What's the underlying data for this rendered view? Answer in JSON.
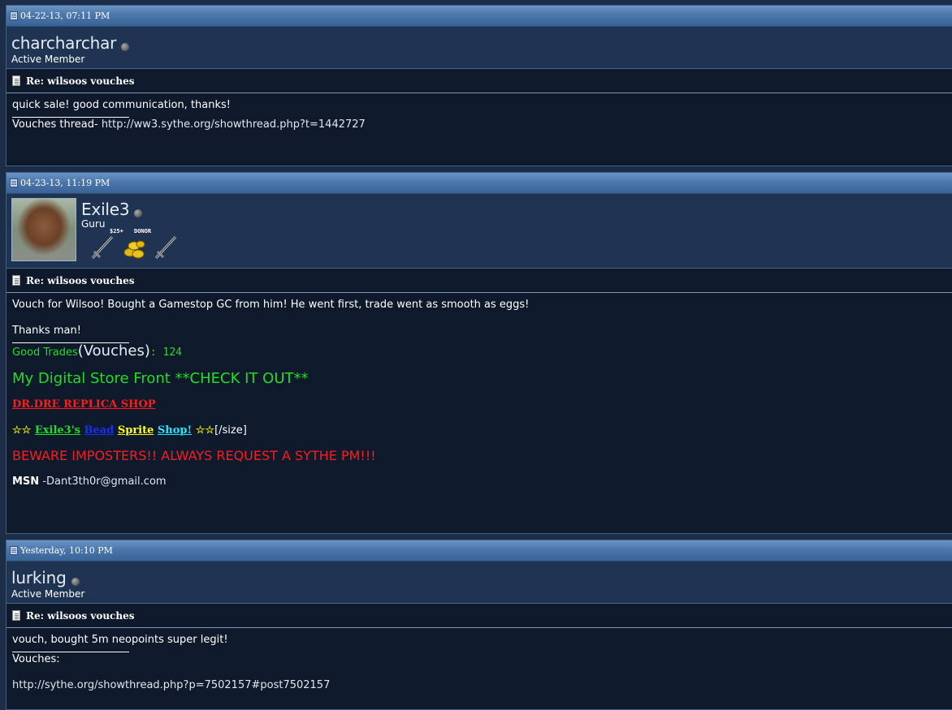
{
  "posts": [
    {
      "date": "04-22-13, 07:11 PM",
      "username": "charcharchar",
      "user_title": "Active Member",
      "message_title": "Re: wilsoos vouches",
      "message": "quick sale! good communication, thanks!",
      "signature": {
        "label": "Vouches thread-",
        "link": "http://ww3.sythe.org/showthread.php?t=1442727"
      }
    },
    {
      "date": "04-23-13, 11:19 PM",
      "username": "Exile3",
      "user_title": "Guru",
      "badges": {
        "badge1_label": "$25+",
        "badge2_label": "DONOR"
      },
      "message_title": "Re: wilsoos vouches",
      "message_line1": "Vouch for Wilsoo! Bought a Gamestop GC from him! He went first, trade went as smooth as eggs!",
      "message_line2": "Thanks man!",
      "signature": {
        "good_trades": "Good Trades",
        "vouches_word": "(Vouches)",
        "vouch_count": ": 124",
        "store_front": "My Digital Store Front **CHECK IT OUT**",
        "replica_shop": "DR.DRE REPLICA SHOP",
        "shop_stars_left": "☆☆",
        "shop_exile": "Exile3's",
        "shop_bead": "Bead",
        "shop_sprite": "Sprite",
        "shop_shop": "Shop!",
        "shop_stars_right": "☆☆",
        "shop_size_tag": "[/size]",
        "beware": "BEWARE IMPOSTERS!! ALWAYS REQUEST A SYTHE PM!!!",
        "msn_label": "MSN",
        "msn_value": "-Dant3th0r@gmail.com"
      }
    },
    {
      "date": "Yesterday, 10:10 PM",
      "username": "lurking",
      "user_title": "Active Member",
      "message_title": "Re: wilsoos vouches",
      "message": "vouch, bought 5m neopoints super legit!",
      "signature": {
        "label": "Vouches:",
        "link": "http://sythe.org/showthread.php?p=7502157#post7502157"
      }
    }
  ],
  "colors": {
    "header_gradient_top": "#6a94c4",
    "post_background": "#0e1a2c",
    "userbar_background": "#1f3453",
    "signature_green": "#22dd22",
    "signature_red": "#ff1b1b"
  }
}
